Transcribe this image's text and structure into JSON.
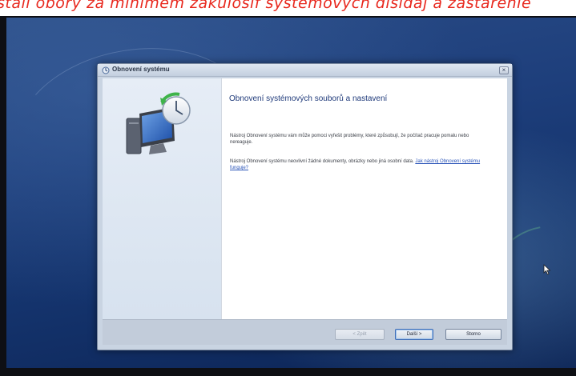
{
  "overlay_caption": "stall obory za minimem zakulosif systemovych disidaj a zastarenie",
  "window": {
    "title": "Obnovení systému",
    "close_label": "×"
  },
  "content": {
    "heading": "Obnovení systémových souborů a nastavení",
    "paragraph1": "Nástroj Obnovení systému vám může pomoci vyřešit problémy, které způsobují, že počítač pracuje pomalu nebo nereaguje.",
    "paragraph2_text": "Nástroj Obnovení systému neovlivní žádné dokumenty, obrázky nebo jiná osobní data.",
    "paragraph2_link": "Jak nástroj Obnovení systému funguje?"
  },
  "footer": {
    "back_label": "< Zpět",
    "next_label": "Další >",
    "cancel_label": "Storno"
  },
  "icons": {
    "window_icon": "system-restore-icon",
    "side_graphic": "system-restore-illustration",
    "cursor": "mouse-pointer-icon"
  }
}
